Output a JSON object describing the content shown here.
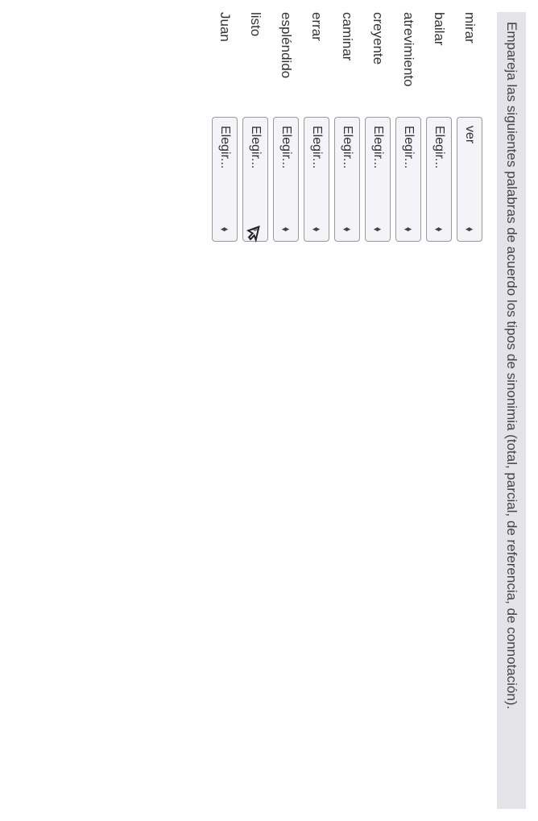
{
  "instruction": "Empareja las siguientes palabras de acuerdo los tipos de sinonimia (total, parcial, de referencia, de connotación).",
  "rows": [
    {
      "label": "mirar",
      "value": "ver"
    },
    {
      "label": "bailar",
      "value": "Elegir..."
    },
    {
      "label": "atrevimiento",
      "value": "Elegir..."
    },
    {
      "label": "creyente",
      "value": "Elegir..."
    },
    {
      "label": "caminar",
      "value": "Elegir..."
    },
    {
      "label": "errar",
      "value": "Elegir..."
    },
    {
      "label": "espléndido",
      "value": "Elegir..."
    },
    {
      "label": "listo",
      "value": "Elegir..."
    },
    {
      "label": "Juan",
      "value": "Elegir..."
    }
  ],
  "arrows": {
    "up": "▲",
    "down": "▼"
  }
}
